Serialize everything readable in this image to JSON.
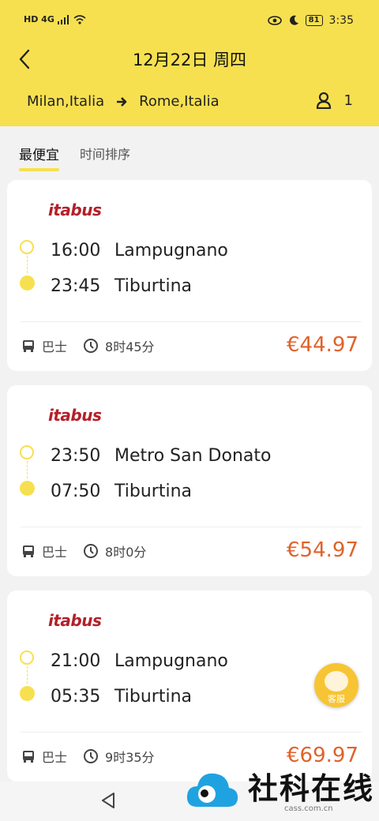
{
  "status_bar": {
    "left": "HD 4G",
    "battery": "81",
    "time": "3:35"
  },
  "header": {
    "title": "12月22日 周四",
    "origin": "Milan,Italia",
    "destination": "Rome,Italia",
    "passengers": "1"
  },
  "tabs": [
    {
      "label": "最便宜",
      "active": true
    },
    {
      "label": "时间排序",
      "active": false
    }
  ],
  "trips": [
    {
      "operator": "itabus",
      "depart_time": "16:00",
      "depart_station": "Lampugnano",
      "arrive_time": "23:45",
      "arrive_station": "Tiburtina",
      "mode": "巴士",
      "duration": "8时45分",
      "price": "€44.97"
    },
    {
      "operator": "itabus",
      "depart_time": "23:50",
      "depart_station": "Metro San Donato",
      "arrive_time": "07:50",
      "arrive_station": "Tiburtina",
      "mode": "巴士",
      "duration": "8时0分",
      "price": "€54.97"
    },
    {
      "operator": "itabus",
      "depart_time": "21:00",
      "depart_station": "Lampugnano",
      "arrive_time": "05:35",
      "arrive_station": "Tiburtina",
      "mode": "巴士",
      "duration": "9时35分",
      "price": "€69.97"
    }
  ],
  "support_button": {
    "label": "客服"
  },
  "watermark": {
    "text": "社科在线",
    "url": "cass.com.cn"
  },
  "colors": {
    "brand_yellow": "#f7e04f",
    "price": "#e0622a",
    "logo_red": "#b3202a"
  }
}
